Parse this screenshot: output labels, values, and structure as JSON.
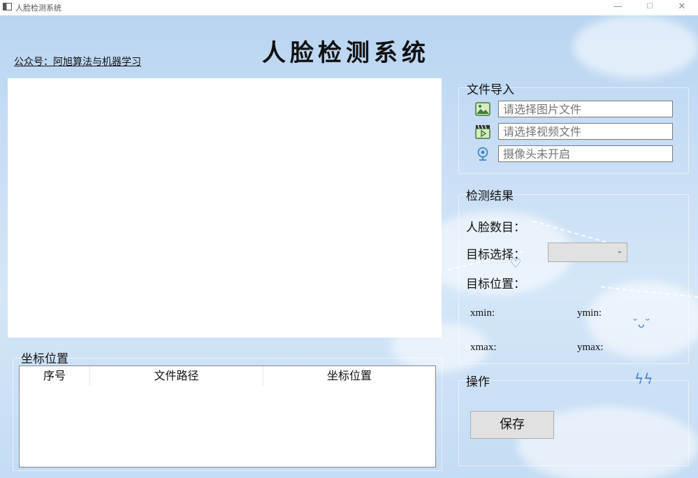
{
  "window": {
    "title": "人脸检测系统",
    "minimize": "—",
    "maximize": "☐",
    "close": "✕"
  },
  "header": {
    "title": "人脸检测系统",
    "subtitle": "公众号：阿旭算法与机器学习"
  },
  "file_import": {
    "title": "文件导入",
    "image_placeholder": "请选择图片文件",
    "video_placeholder": "请选择视频文件",
    "camera_placeholder": "摄像头未开启",
    "icons": [
      "image-icon",
      "video-icon",
      "camera-icon"
    ]
  },
  "results": {
    "title": "检测结果",
    "face_count_label": "人脸数目：",
    "target_select_label": "目标选择：",
    "target_position_label": "目标位置：",
    "target_select_value": "",
    "xmin_label": "xmin:",
    "ymin_label": "ymin:",
    "xmax_label": "xmax:",
    "ymax_label": "ymax:"
  },
  "operations": {
    "title": "操作",
    "save_label": "保存"
  },
  "coords_table": {
    "title": "坐标位置",
    "columns": [
      "序号",
      "文件路径",
      "坐标位置"
    ],
    "rows": []
  },
  "colors": {
    "background": "#c8def5",
    "accent": "#4a7fc8"
  }
}
